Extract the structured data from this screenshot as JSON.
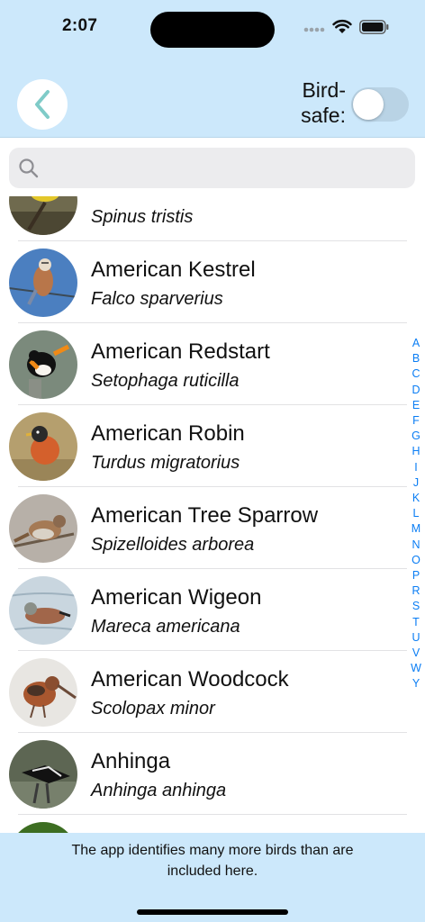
{
  "status_bar": {
    "time": "2:07",
    "icons": [
      "signal-dots-icon",
      "wifi-icon",
      "battery-icon"
    ]
  },
  "header": {
    "back_icon": "chevron-left-icon",
    "birdsafe_label": "Bird-safe:",
    "birdsafe_line1": "Bird-",
    "birdsafe_line2": "safe:",
    "birdsafe_enabled": false
  },
  "search": {
    "icon": "search-icon",
    "value": "",
    "placeholder": ""
  },
  "birds": [
    {
      "common": "",
      "scientific": "Spinus tristis",
      "photo": "goldfinch"
    },
    {
      "common": "American Kestrel",
      "scientific": "Falco sparverius",
      "photo": "kestrel"
    },
    {
      "common": "American Redstart",
      "scientific": "Setophaga ruticilla",
      "photo": "redstart"
    },
    {
      "common": "American Robin",
      "scientific": "Turdus migratorius",
      "photo": "robin"
    },
    {
      "common": "American Tree Sparrow",
      "scientific": "Spizelloides arborea",
      "photo": "tree-sparrow"
    },
    {
      "common": "American Wigeon",
      "scientific": "Mareca americana",
      "photo": "wigeon"
    },
    {
      "common": "American Woodcock",
      "scientific": "Scolopax minor",
      "photo": "woodcock"
    },
    {
      "common": "Anhinga",
      "scientific": "Anhinga anhinga",
      "photo": "anhinga"
    },
    {
      "common": "",
      "scientific": "",
      "photo": "green-partial"
    }
  ],
  "section_index": [
    "A",
    "B",
    "C",
    "D",
    "E",
    "F",
    "G",
    "H",
    "I",
    "J",
    "K",
    "L",
    "M",
    "N",
    "O",
    "P",
    "R",
    "S",
    "T",
    "U",
    "V",
    "W",
    "Y"
  ],
  "footer": {
    "note": "The app identifies many more birds than are included here."
  },
  "colors": {
    "header_bg": "#cce8fb",
    "accent_teal": "#7fcbc8",
    "index_blue": "#0a7df4",
    "toggle_off": "#b9d3e5"
  }
}
